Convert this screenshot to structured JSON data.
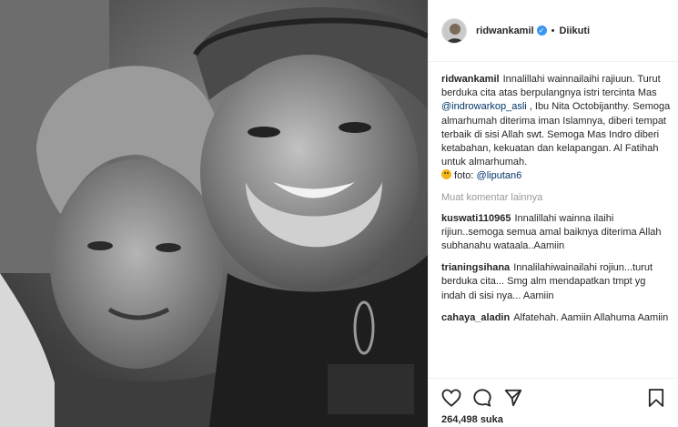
{
  "post": {
    "username": "ridwankamil",
    "follow_label": "Diikuti",
    "separator": "•"
  },
  "caption": {
    "username": "ridwankamil",
    "text_part1": "Innalillahi wainnailaihi rajiuun. Turut berduka cita atas berpulangnya istri tercinta Mas ",
    "mention_1": "@indrowarkop_asli",
    "text_part2": " , Ibu Nita Octobijanthy. Semoga almarhumah diterima iman Islamnya, diberi tempat terbaik di sisi Allah swt. Semoga Mas Indro diberi ketabahan, kekuatan dan kelapangan. Al Fatihah untuk almarhumah.",
    "text_part3": " foto: ",
    "mention_2": "@liputan6"
  },
  "more_comments_label": "Muat komentar lainnya",
  "comments": [
    {
      "username": "kuswati110965",
      "text": "Innalillahi wainna ilaihi rijiun..semoga semua amal baiknya diterima Allah subhanahu wataala..Aamiin"
    },
    {
      "username": "trianingsihana",
      "text": "Innalilahiwainailahi rojiun...turut berduka cita... Smg alm mendapatkan tmpt yg indah di sisi nya... Aamiin"
    },
    {
      "username": "cahaya_aladin",
      "text": "Alfatehah. Aamiin Allahuma Aamiin"
    }
  ],
  "likes_label": "264,498 suka",
  "icons": {
    "like": "heart-icon",
    "comment": "comment-icon",
    "share": "share-icon",
    "save": "bookmark-icon",
    "verified": "verified-badge-icon"
  }
}
